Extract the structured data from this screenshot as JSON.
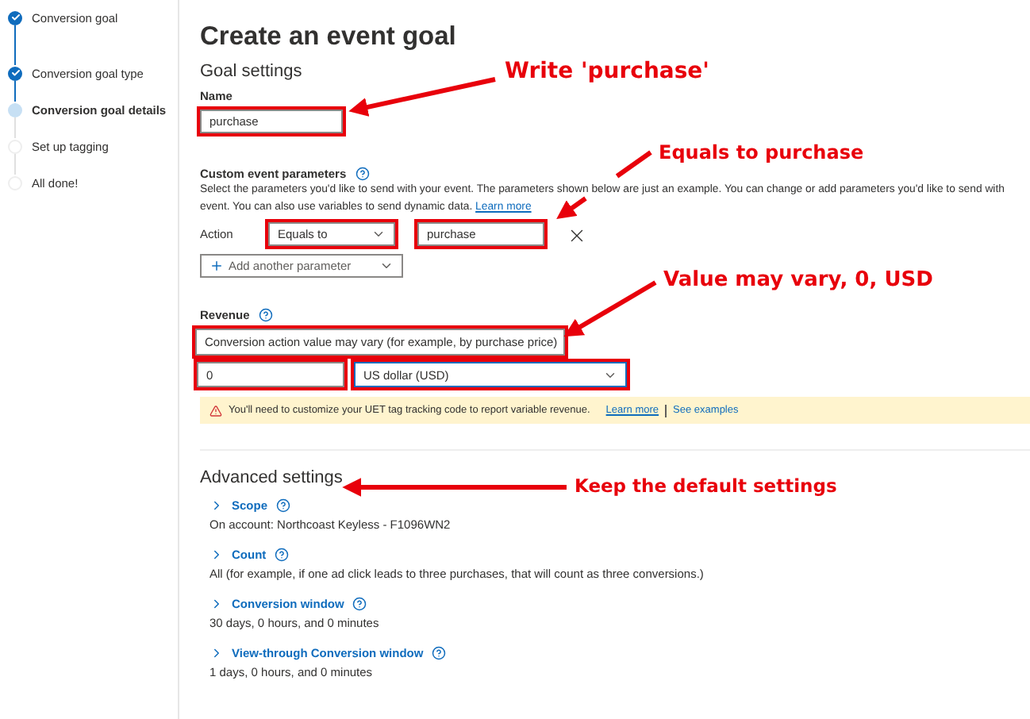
{
  "sidebar": {
    "steps": [
      {
        "label": "Conversion goal",
        "done": true,
        "selected": false
      },
      {
        "label": "Conversion goal type",
        "done": true,
        "selected": false
      },
      {
        "label": "Conversion goal details",
        "done": false,
        "selected": true
      },
      {
        "label": "Set up tagging",
        "done": false,
        "selected": false
      },
      {
        "label": "All done!",
        "done": false,
        "selected": false
      }
    ]
  },
  "page": {
    "title": "Create an event goal",
    "section": "Goal settings"
  },
  "name_field": {
    "label": "Name",
    "value": "purchase",
    "highlighted": true
  },
  "custom_params": {
    "label": "Custom event parameters",
    "description": "Select the parameters you'd like to send with your event. The parameters shown below are just an example. You can change or add parameters you'd like to send with event. You can also use variables to send dynamic data.",
    "link": "Learn more",
    "action_label": "Action",
    "operator": {
      "value": "Equals to",
      "highlighted": true
    },
    "value": {
      "value": "purchase",
      "highlighted": true
    },
    "add_button": "Add another parameter"
  },
  "revenue": {
    "label": "Revenue",
    "type": {
      "value": "Conversion action value may vary (for example, by purchase price)",
      "highlighted": true
    },
    "amount": {
      "value": "0",
      "highlighted": true
    },
    "currency": {
      "value": "US dollar (USD)",
      "highlighted": true,
      "focused": true
    }
  },
  "warning": {
    "text": "You'll need to customize your UET tag tracking code to report variable revenue.",
    "links": [
      "Learn more",
      "See examples"
    ]
  },
  "advanced": {
    "title": "Advanced settings",
    "items": [
      {
        "label": "Scope",
        "value": "On account: Northcoast Keyless - F1096WN2"
      },
      {
        "label": "Count",
        "value": "All (for example, if one ad click leads to three purchases, that will count as three conversions.)"
      },
      {
        "label": "Conversion window",
        "value": "30 days, 0 hours, and 0 minutes"
      },
      {
        "label": "View-through Conversion window",
        "value": "1 days, 0 hours, and 0 minutes"
      }
    ]
  },
  "annotations": [
    {
      "text": "Write 'purchase'"
    },
    {
      "text": "Equals to purchase"
    },
    {
      "text": "Value may vary, 0, USD"
    },
    {
      "text": "Keep the default settings"
    }
  ]
}
